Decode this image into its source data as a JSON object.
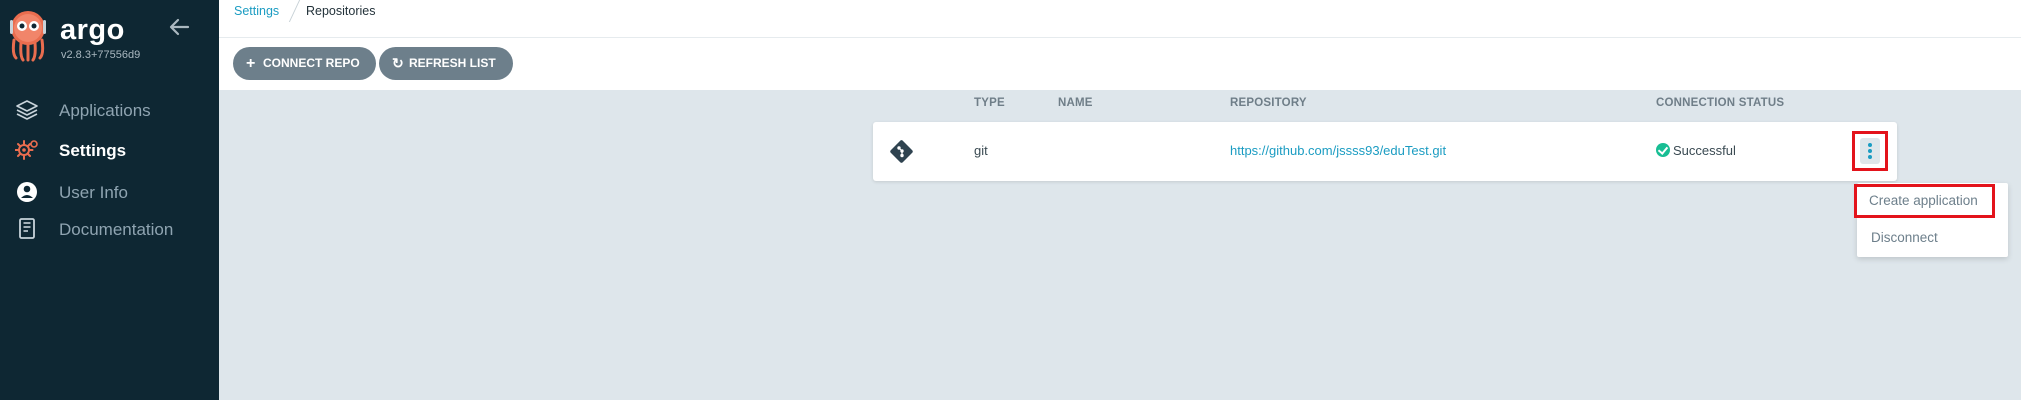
{
  "sidebar": {
    "brand": "argo",
    "version": "v2.8.3+77556d9",
    "items": [
      {
        "label": "Applications",
        "icon": "layers-icon"
      },
      {
        "label": "Settings",
        "icon": "gears-icon",
        "active": true
      },
      {
        "label": "User Info",
        "icon": "user-circle-icon"
      },
      {
        "label": "Documentation",
        "icon": "book-icon"
      }
    ]
  },
  "breadcrumb": {
    "parent": "Settings",
    "current": "Repositories"
  },
  "toolbar": {
    "connect_label": "CONNECT REPO",
    "refresh_label": "REFRESH LIST"
  },
  "table": {
    "headers": {
      "type": "TYPE",
      "name": "NAME",
      "repository": "REPOSITORY",
      "status": "CONNECTION STATUS"
    },
    "rows": [
      {
        "type": "git",
        "name": "",
        "repository": "https://github.com/jssss93/eduTest.git",
        "status": "Successful"
      }
    ]
  },
  "menu": {
    "items": [
      "Create application",
      "Disconnect"
    ]
  },
  "colors": {
    "sidebar_bg": "#0e2733",
    "accent": "#1b9cc2",
    "success": "#18be94",
    "button": "#6d7f8b",
    "highlight": "#e3131b"
  }
}
